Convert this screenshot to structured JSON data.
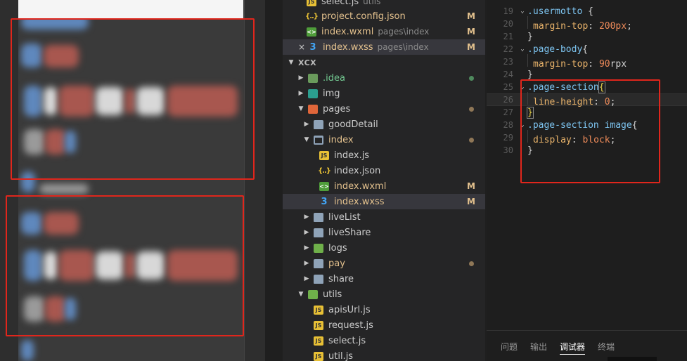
{
  "explorer": {
    "rows": [
      {
        "label": "select.js",
        "desc": "utils",
        "icon": "js"
      },
      {
        "label": "project.config.json",
        "desc": "",
        "badge": "M",
        "icon": "json"
      },
      {
        "label": "index.wxml",
        "desc": "pages\\index",
        "badge": "M",
        "icon": "wxml"
      },
      {
        "label": "index.wxss",
        "desc": "pages\\index",
        "badge": "M",
        "icon": "css",
        "close": "×"
      }
    ],
    "section_title": "XCX",
    "tree": {
      "idea": ".idea",
      "img": "img",
      "pages": "pages",
      "goodDetail": "goodDetail",
      "index": "index",
      "index_js": "index.js",
      "index_json": "index.json",
      "index_wxml": "index.wxml",
      "index_wxml_badge": "M",
      "index_wxss": "index.wxss",
      "index_wxss_badge": "M",
      "liveList": "liveList",
      "liveShare": "liveShare",
      "logs": "logs",
      "pay": "pay",
      "share": "share",
      "utils": "utils",
      "apisUrl": "apisUrl.js",
      "request": "request.js",
      "select": "select.js",
      "util": "util.js"
    },
    "json_icon_glyph": "{..}",
    "css_icon_glyph": "3",
    "js_icon_glyph": "JS",
    "wxml_icon_glyph": "<>"
  },
  "editor": {
    "line_numbers": [
      "19",
      "20",
      "21",
      "22",
      "23",
      "24",
      "25",
      "26",
      "27",
      "28",
      "29",
      "30"
    ],
    "lines": {
      "l19_sel": ".usermotto",
      "l19_brace": "{",
      "l20_prop": "margin-top",
      "l20_colon": ": ",
      "l20_val": "200px",
      "l20_semi": ";",
      "l21": "}",
      "l22_sel": ".page-body",
      "l22_brace": "{",
      "l23_prop": "margin-top",
      "l23_colon": ": ",
      "l23_num": "90",
      "l23_unit": "rpx",
      "l24": "}",
      "l25_sel": ".page-section",
      "l25_brace": "{",
      "l26_prop": "line-height",
      "l26_colon": ": ",
      "l26_val": "0",
      "l26_semi": ";",
      "l27": "}",
      "l28_sel": ".page-section image",
      "l28_brace": "{",
      "l29_prop": "display",
      "l29_colon": ": ",
      "l29_val": "block",
      "l29_semi": ";",
      "l30": "}"
    }
  },
  "bottom_panel": {
    "tabs": [
      "问题",
      "输出",
      "调试器",
      "终端"
    ],
    "active_tab": "调试器"
  },
  "colors": {
    "annotation_red": "#e0261c",
    "modified": "#e2c08d",
    "selector": "#7dc4f0",
    "property": "#e9b36a",
    "number": "#f08c5a"
  }
}
